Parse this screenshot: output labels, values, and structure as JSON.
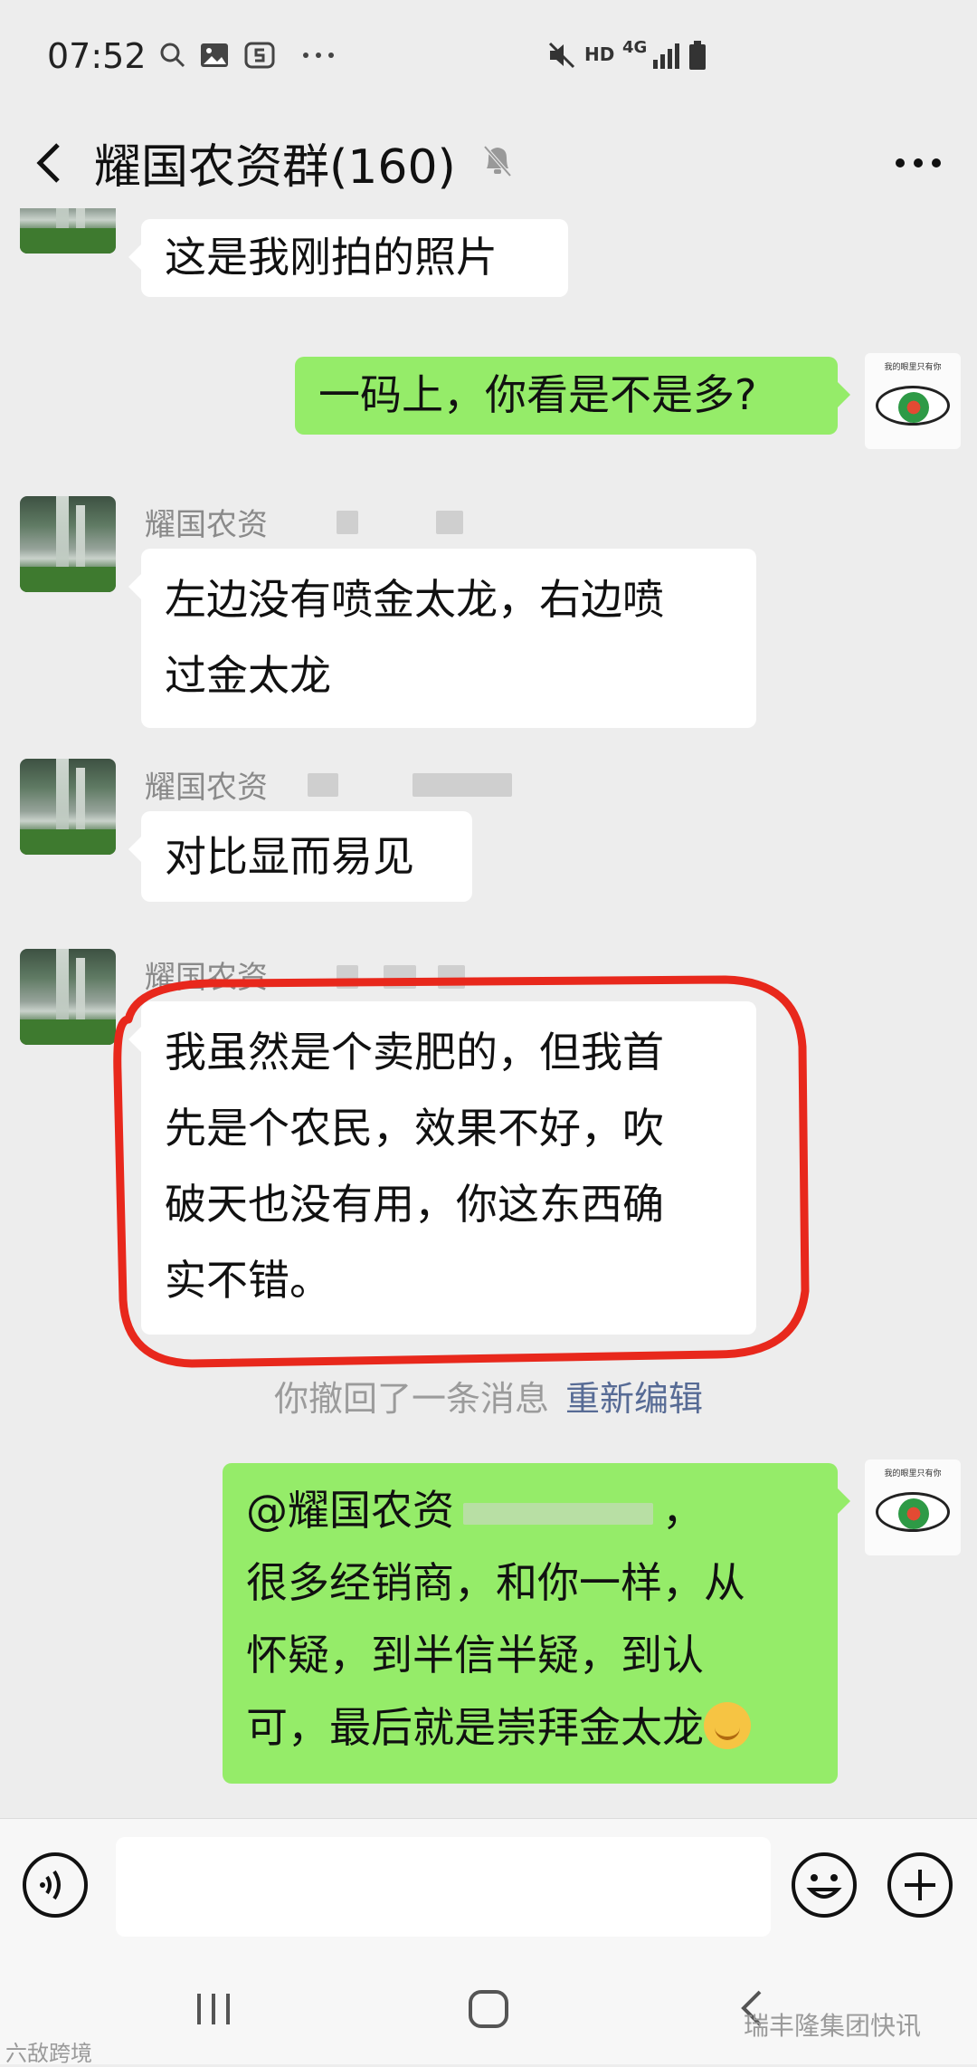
{
  "status_bar": {
    "time": "07:52",
    "left_icons": [
      "search-icon",
      "gallery-icon",
      "s-app-icon",
      "more-dots-icon"
    ],
    "right_icons": [
      "mute-icon",
      "hd-icon",
      "4g-icon",
      "signal-icon",
      "battery-icon"
    ],
    "hd_label": "HD",
    "network_label": "4G"
  },
  "header": {
    "title": "耀国农资群(160)",
    "muted": true
  },
  "messages": [
    {
      "direction": "in",
      "text": "这是我刚拍的照片"
    },
    {
      "direction": "out",
      "text": "一码上，你看是不是多?"
    },
    {
      "direction": "in",
      "sender": "耀国农资",
      "lines": [
        "左边没有喷金太龙，右边喷",
        "过金太龙"
      ]
    },
    {
      "direction": "in",
      "sender": "耀国农资",
      "text": "对比显而易见"
    },
    {
      "direction": "in",
      "sender": "耀国农资",
      "highlighted": true,
      "lines": [
        "我虽然是个卖肥的，但我首",
        "先是个农民，效果不好，吹",
        "破天也没有用，你这东西确",
        "实不错。"
      ]
    },
    {
      "direction": "out",
      "mention": "@耀国农资",
      "mention_tail": "，",
      "lines": [
        "很多经销商，和你一样，从",
        "怀疑，到半信半疑，到认",
        "可，最后就是崇拜金太龙"
      ],
      "emoji": "smirk-emoji"
    }
  ],
  "recall_notice": {
    "text": "你撤回了一条消息",
    "action": "重新编辑"
  },
  "self_avatar_caption": "我的眼里只有你",
  "colors": {
    "background": "#ededed",
    "bubble_in": "#ffffff",
    "bubble_out": "#95ec69",
    "link": "#576b95",
    "highlight": "#e8281c"
  },
  "watermarks": {
    "left": "六敌跨境",
    "right": "瑞丰隆集团快讯"
  }
}
